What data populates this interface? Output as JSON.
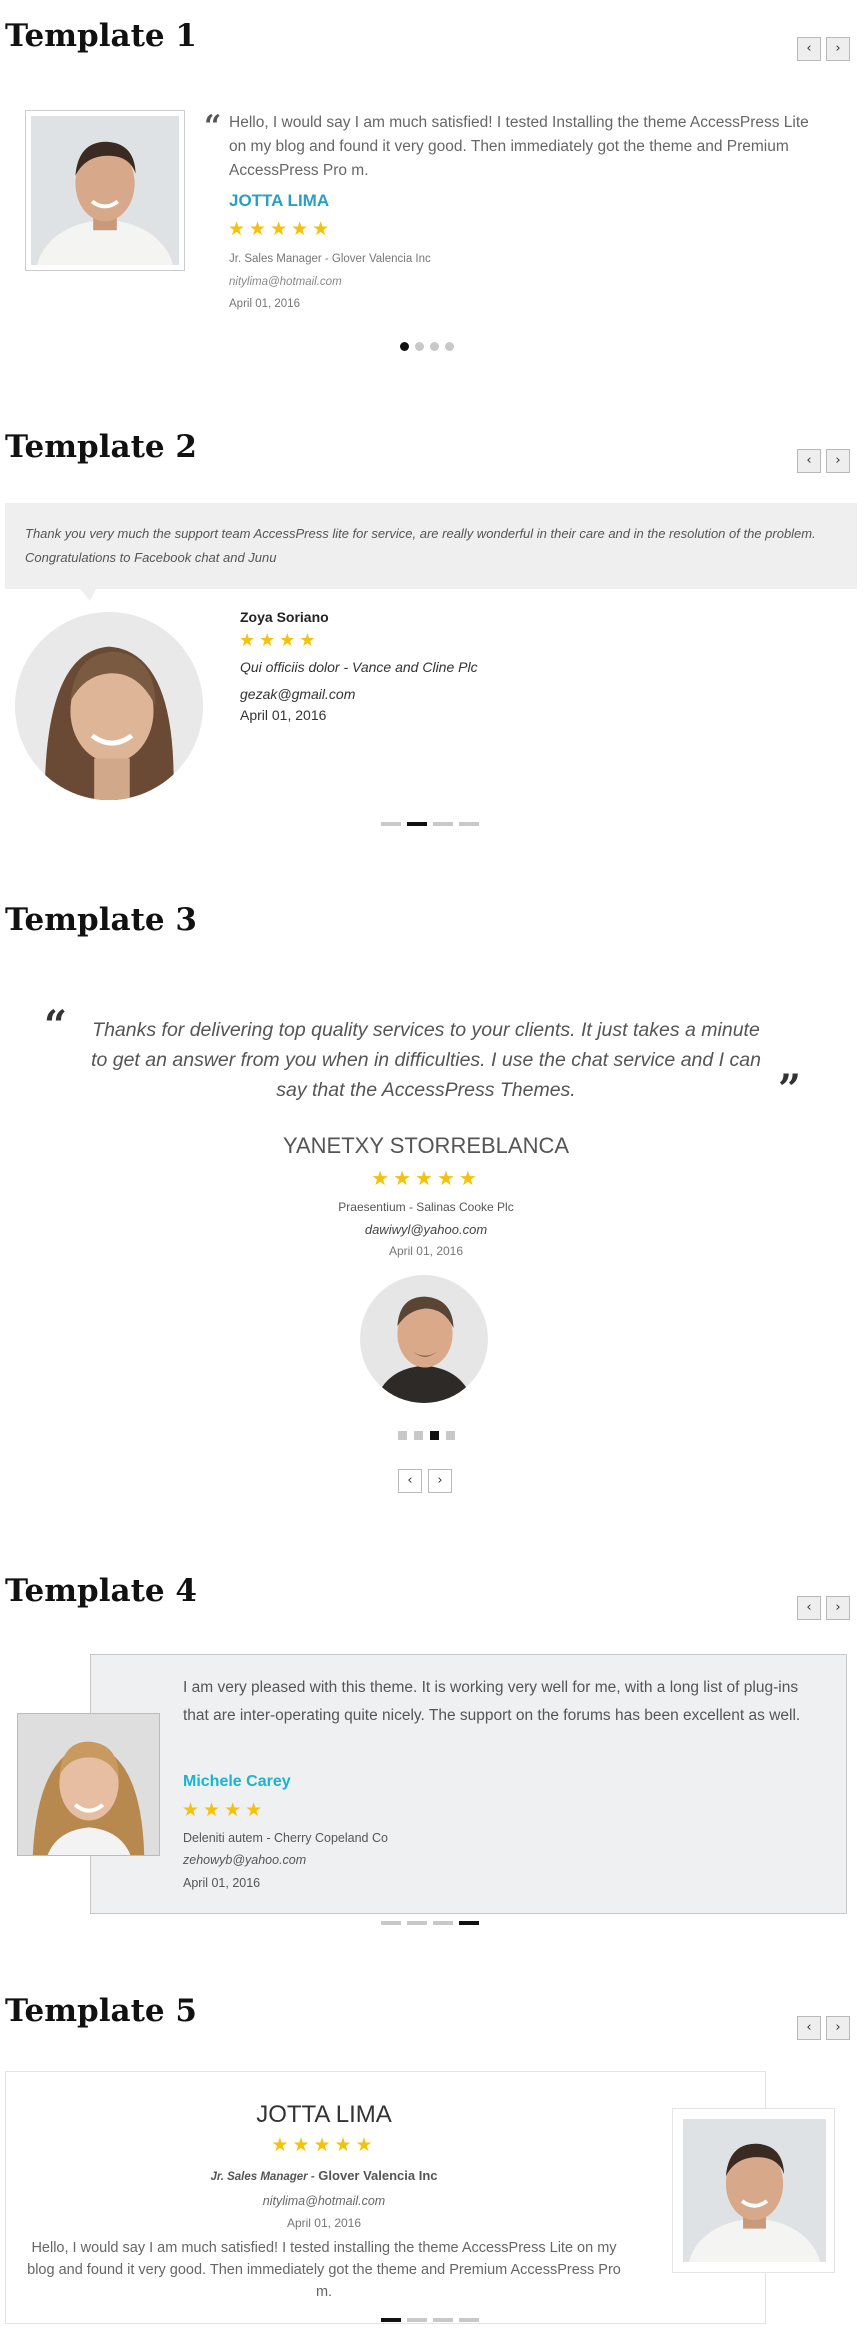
{
  "colors": {
    "accent_t1": "#2a9fbf",
    "accent_t4": "#19b5cf",
    "star": "#f4c20d",
    "panel": "#efefef"
  },
  "icons": {
    "prev": "chevron-left-icon",
    "next": "chevron-right-icon",
    "quote_open": "quote-open-icon",
    "quote_close": "quote-close-icon",
    "star": "star-icon"
  },
  "nav": {
    "prev": "‹",
    "next": "›"
  },
  "t1": {
    "heading": "Template 1",
    "quote_mark": "“",
    "text": "Hello, I would say I am much satisfied! I tested Installing the theme AccessPress Lite on my blog and found it very good. Then immediately got the theme and Premium AccessPress Pro m.",
    "name": "JOTTA LIMA",
    "stars": "★★★★★",
    "position": "Jr. Sales Manager -  Glover Valencia Inc",
    "email": "nitylima@hotmail.com",
    "date": "April 01, 2016",
    "pager": {
      "count": 4,
      "active": 1
    }
  },
  "t2": {
    "heading": "Template 2",
    "text": "Thank you very much the support team AccessPress lite for service, are really wonderful in their care and in the resolution of the problem. Congratulations to Facebook chat and Junu",
    "name": "Zoya Soriano",
    "stars": "★★★★",
    "position": "Qui officiis dolor -  Vance and Cline Plc",
    "email": "gezak@gmail.com",
    "date": "April 01, 2016",
    "pager": {
      "count": 4,
      "active": 2
    }
  },
  "t3": {
    "heading": "Template 3",
    "quote_open": "“",
    "quote_close": "”",
    "text": "Thanks for delivering top quality services to your clients. It just takes a minute to get an answer from you when in difficulties. I use the chat service and I can say that the AccessPress Themes.",
    "name": "YANETXY STORREBLANCA",
    "stars": "★★★★★",
    "position": "Praesentium -  Salinas Cooke Plc",
    "email": "dawiwyl@yahoo.com",
    "date": "April 01, 2016",
    "pager": {
      "count": 4,
      "active": 3
    }
  },
  "t4": {
    "heading": "Template 4",
    "text": "I am very pleased with this theme. It is working very well for me, with a long list of plug-ins that are inter-operating quite nicely. The support on the forums has been excellent as well.",
    "name": "Michele Carey",
    "stars": "★★★★",
    "position": "Deleniti autem -  Cherry Copeland Co",
    "email": "zehowyb@yahoo.com",
    "date": "April 01, 2016",
    "pager": {
      "count": 4,
      "active": 4
    }
  },
  "t5": {
    "heading": "Template 5",
    "name": "JOTTA LIMA",
    "stars": "★★★★★",
    "role": "Jr. Sales Manager -",
    "company": "Glover Valencia Inc",
    "email": "nitylima@hotmail.com",
    "date": "April 01, 2016",
    "text": "Hello, I would say I am much satisfied! I tested installing the theme AccessPress Lite on my blog and found it very good. Then immediately got the theme and Premium AccessPress Pro m.",
    "pager": {
      "count": 4,
      "active": 1
    }
  }
}
